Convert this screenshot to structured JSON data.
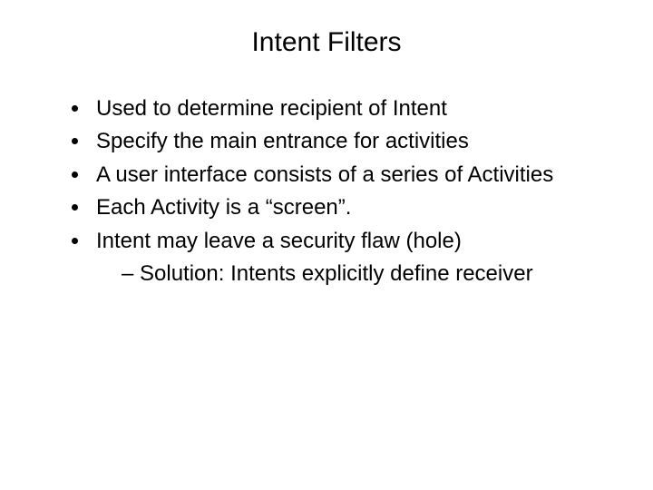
{
  "slide": {
    "title": "Intent Filters",
    "bullets": [
      {
        "text": "Used to determine recipient of Intent"
      },
      {
        "text": "Specify the main entrance for activities"
      },
      {
        "text": "A user interface consists of a series of Activities"
      },
      {
        "text": "Each Activity is a “screen”."
      },
      {
        "text": "Intent may leave a  security flaw (hole)",
        "sub": [
          "Solution: Intents explicitly define receiver"
        ]
      }
    ]
  }
}
